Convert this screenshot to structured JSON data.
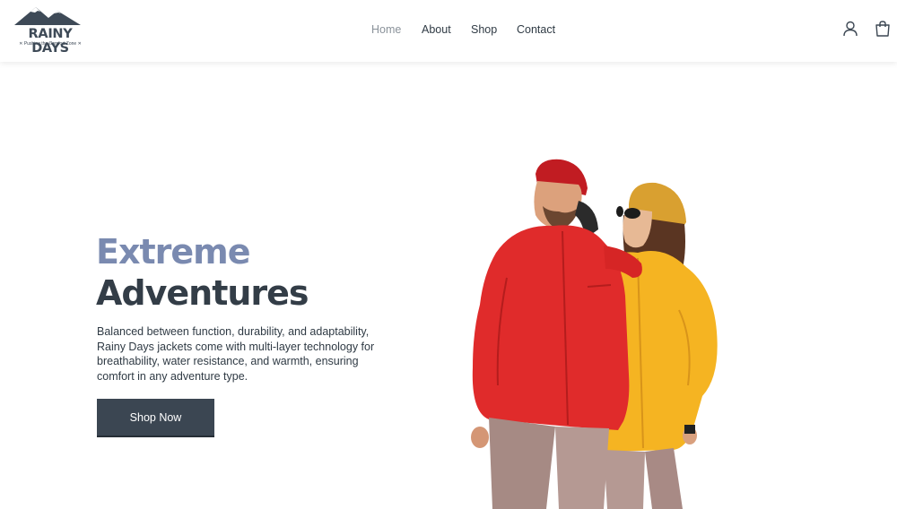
{
  "brand": {
    "name": "RAINY DAYS",
    "tagline": "✕ Pushing the Comfort Zone ✕"
  },
  "nav": {
    "items": [
      {
        "label": "Home",
        "active": true
      },
      {
        "label": "About",
        "active": false
      },
      {
        "label": "Shop",
        "active": false
      },
      {
        "label": "Contact",
        "active": false
      }
    ]
  },
  "header_icons": [
    "user-icon",
    "shopping-bag-icon"
  ],
  "hero": {
    "title_line1": "Extreme",
    "title_line2": "Adventures",
    "description": "Balanced between function, durability, and adaptability, Rainy Days jackets come with multi-layer technology for breathability, water resistance, and warmth, ensuring comfort in any adventure type.",
    "cta_label": "Shop Now"
  },
  "colors": {
    "accent": "#7a8ab0",
    "dark": "#333d47",
    "button": "#3b4652",
    "jacket_red": "#e02b2b",
    "jacket_yellow": "#f5b422"
  }
}
